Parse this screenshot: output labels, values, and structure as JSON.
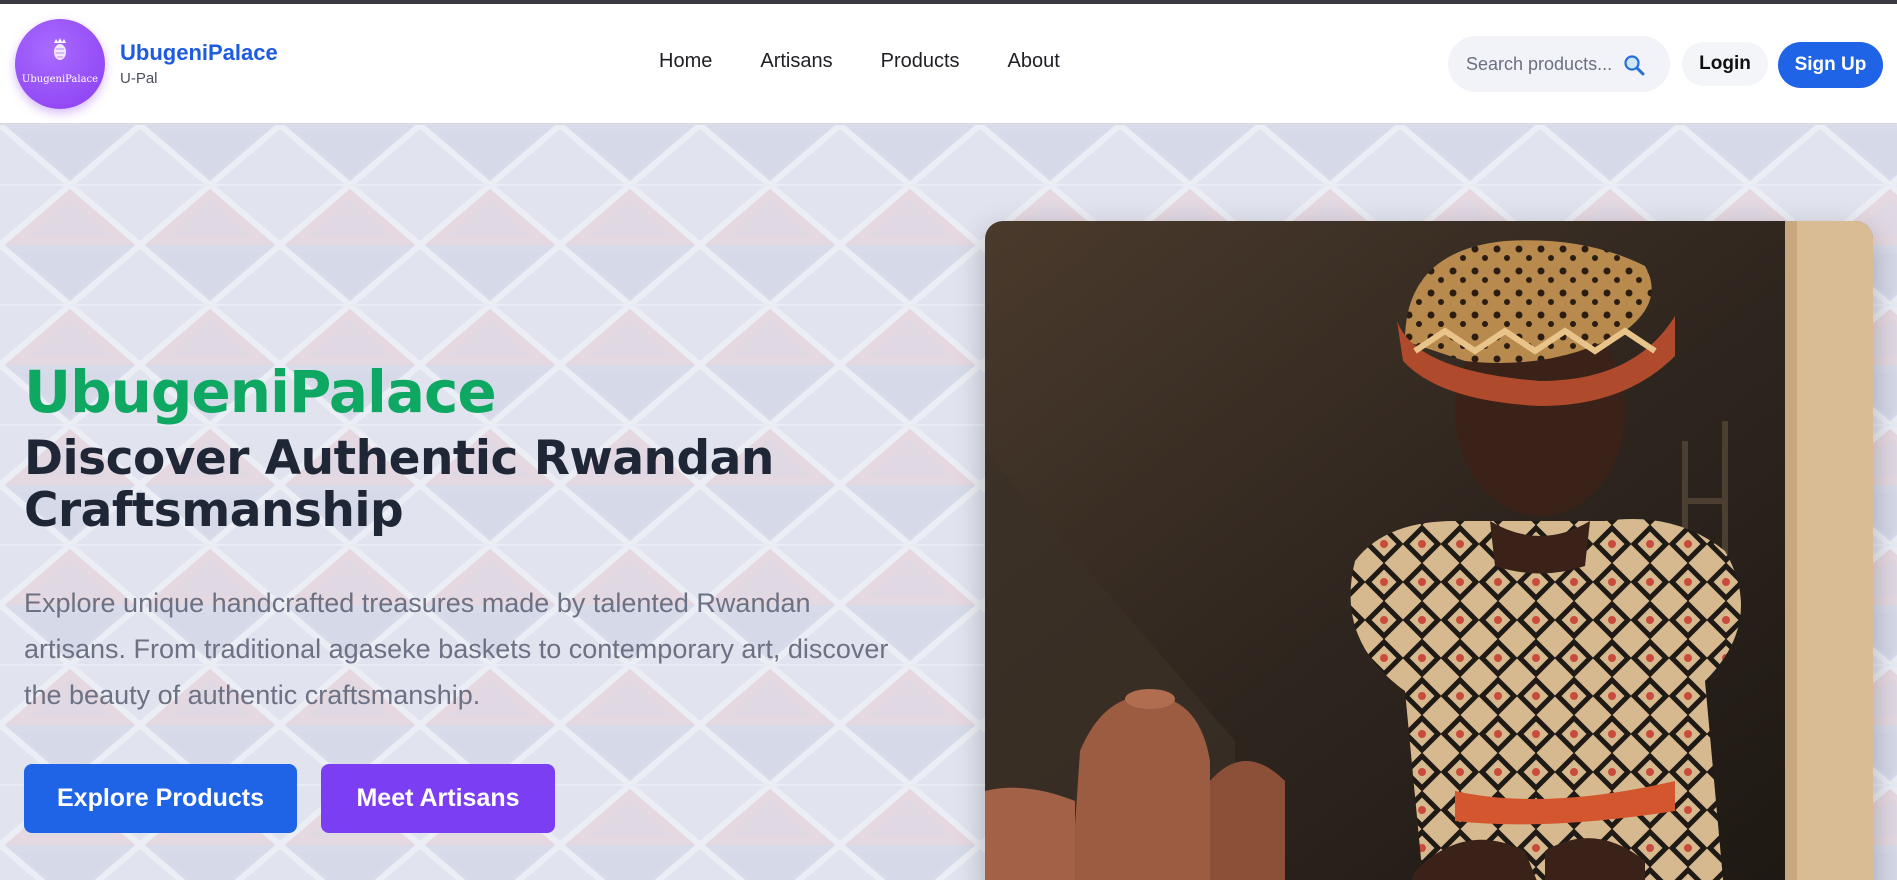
{
  "brand": {
    "logo_text": "UbugeniPalace",
    "name": "UbugeniPalace",
    "subtitle": "U-Pal"
  },
  "nav": {
    "items": [
      {
        "label": "Home"
      },
      {
        "label": "Artisans"
      },
      {
        "label": "Products"
      },
      {
        "label": "About"
      }
    ]
  },
  "search": {
    "placeholder": "Search products...",
    "icon": "magnifier-icon"
  },
  "auth": {
    "login_label": "Login",
    "signup_label": "Sign Up"
  },
  "hero": {
    "title": "UbugeniPalace",
    "heading": "Discover Authentic Rwandan Craftsmanship",
    "description": "Explore unique handcrafted treasures made by talented Rwandan artisans. From traditional agaseke baskets to contemporary art, discover the beauty of authentic craftsmanship.",
    "explore_label": "Explore Products",
    "artisans_label": "Meet Artisans"
  },
  "colors": {
    "brand_blue": "#1f63e6",
    "brand_purple": "#7b3ef2",
    "title_green": "#0fa863",
    "heading_dark": "#1f2636"
  }
}
